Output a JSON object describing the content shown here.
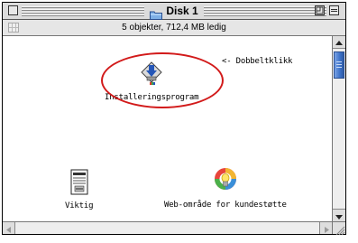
{
  "window": {
    "title": "Disk 1",
    "info": "5 objekter, 712,4 MB ledig"
  },
  "items": {
    "installer": {
      "label": "Installeringsprogram",
      "icon": "installer-icon"
    },
    "readme": {
      "label": "Viktig",
      "icon": "document-icon"
    },
    "support": {
      "label": "Web-område for kundestøtte",
      "icon": "lightbulb-icon"
    }
  },
  "annotation": {
    "text": "<- Dobbeltklikk",
    "color": "#d21a1a"
  },
  "colors": {
    "scroll_thumb": "#3d72c8",
    "highlight_circle": "#d21a1a"
  }
}
